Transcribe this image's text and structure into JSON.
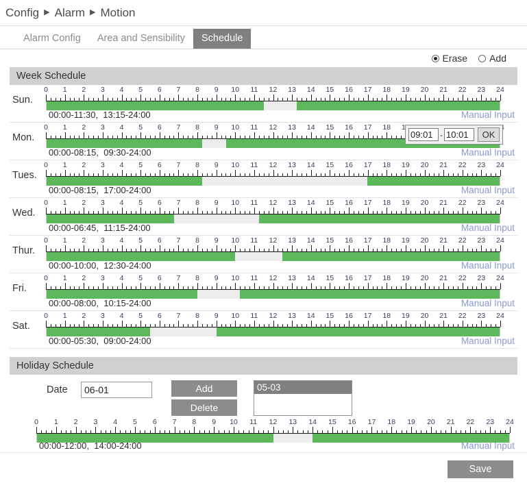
{
  "breadcrumb": {
    "items": [
      "Config",
      "Alarm",
      "Motion"
    ],
    "separator": "▶"
  },
  "tabs": [
    {
      "label": "Alarm Config",
      "active": false
    },
    {
      "label": "Area and Sensibility",
      "active": false
    },
    {
      "label": "Schedule",
      "active": true
    }
  ],
  "mode": {
    "erase_label": "Erase",
    "add_label": "Add",
    "selected": "Erase"
  },
  "week_section": {
    "title": "Week Schedule"
  },
  "holiday_section": {
    "title": "Holiday Schedule"
  },
  "scale": {
    "ticks": [
      "0",
      "1",
      "2",
      "3",
      "4",
      "5",
      "6",
      "7",
      "8",
      "9",
      "10",
      "11",
      "12",
      "13",
      "14",
      "15",
      "16",
      "17",
      "18",
      "19",
      "20",
      "21",
      "22",
      "23",
      "24"
    ],
    "minor_per_hour": 4
  },
  "manual_input_label": "Manual Input",
  "manual_popup": {
    "visible_on_day": "Mon.",
    "start": "09:01",
    "end": "10:01",
    "dash": "-",
    "ok_label": "OK"
  },
  "days": [
    {
      "label": "Sun.",
      "times": "00:00-11:30,  13:15-24:00",
      "segments": [
        {
          "start": 0,
          "end": 11.5
        },
        {
          "start": 13.25,
          "end": 24
        }
      ]
    },
    {
      "label": "Mon.",
      "times": "00:00-08:15,  09:30-24:00",
      "segments": [
        {
          "start": 0,
          "end": 8.25
        },
        {
          "start": 9.5,
          "end": 24
        }
      ]
    },
    {
      "label": "Tues.",
      "times": "00:00-08:15,  17:00-24:00",
      "segments": [
        {
          "start": 0,
          "end": 8.25
        },
        {
          "start": 17,
          "end": 24
        }
      ]
    },
    {
      "label": "Wed.",
      "times": "00:00-06:45,  11:15-24:00",
      "segments": [
        {
          "start": 0,
          "end": 6.75
        },
        {
          "start": 11.25,
          "end": 24
        }
      ]
    },
    {
      "label": "Thur.",
      "times": "00:00-10:00,  12:30-24:00",
      "segments": [
        {
          "start": 0,
          "end": 10
        },
        {
          "start": 12.5,
          "end": 24
        }
      ]
    },
    {
      "label": "Fri.",
      "times": "00:00-08:00,  10:15-24:00",
      "segments": [
        {
          "start": 0,
          "end": 8
        },
        {
          "start": 10.25,
          "end": 24
        }
      ]
    },
    {
      "label": "Sat.",
      "times": "00:00-05:30,  09:00-24:00",
      "segments": [
        {
          "start": 0,
          "end": 5.5
        },
        {
          "start": 9,
          "end": 24
        }
      ]
    }
  ],
  "holiday": {
    "date_label": "Date",
    "date_value": "06-01",
    "add_label": "Add",
    "delete_label": "Delete",
    "list": [
      {
        "value": "05-03",
        "selected": true
      }
    ],
    "times": "00:00-12:00,  14:00-24:00",
    "segments": [
      {
        "start": 0,
        "end": 12
      },
      {
        "start": 14,
        "end": 24
      }
    ]
  },
  "footer": {
    "save_label": "Save"
  },
  "colors": {
    "active_green": "#5cb85a",
    "track_empty": "#ececec",
    "band_gray": "#d0d0d0",
    "button_gray": "#8c8c8c",
    "link_blue": "#8c9ad4"
  }
}
